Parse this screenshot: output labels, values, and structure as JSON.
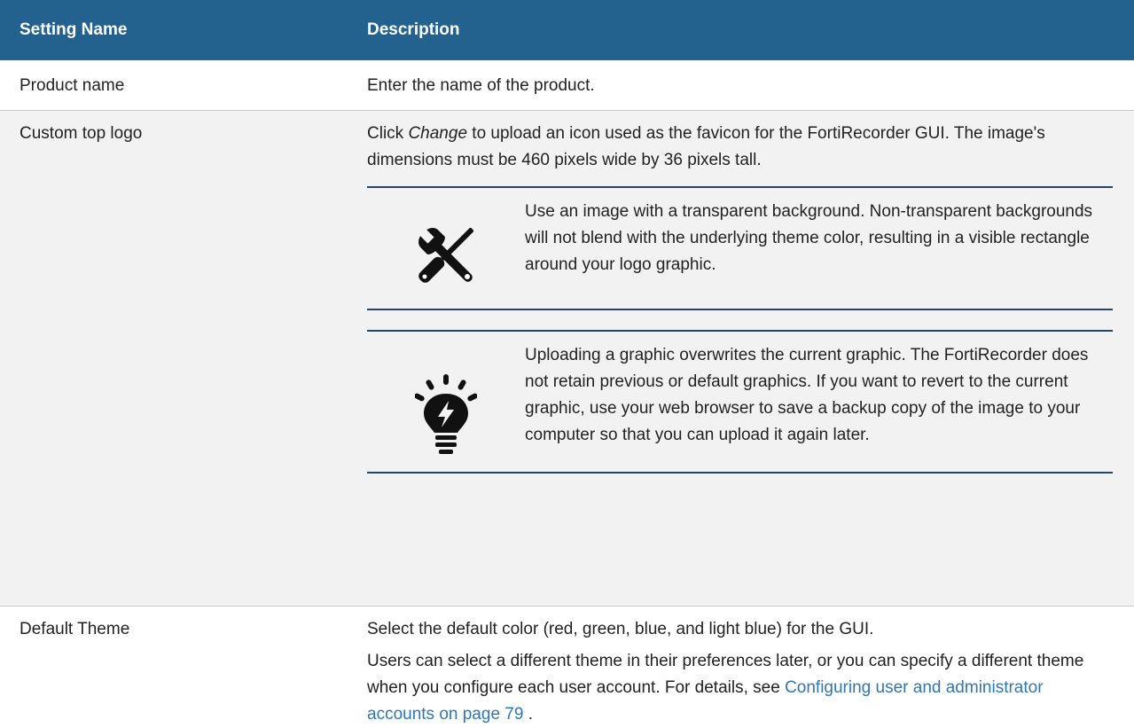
{
  "header": {
    "col1": "Setting Name",
    "col2": "Description"
  },
  "rows": [
    {
      "name": "Product name",
      "description": "Enter the name of the product."
    },
    {
      "name": "Custom top logo",
      "desc_pre": "Click ",
      "desc_em": "Change",
      "desc_post": " to upload an icon used as the favicon for the FortiRecorder GUI. The image's dimensions must be 460 pixels wide by 36 pixels tall.",
      "note_caution": {
        "icon": "tools-icon",
        "text": "Use an image with a transparent background. Non-transparent backgrounds will not blend with the underlying theme color, resulting in a visible rectangle around your logo graphic."
      },
      "note_tip": {
        "icon": "lightbulb-icon",
        "text": "Uploading a graphic overwrites the current graphic. The FortiRecorder does not retain previous or default graphics. If you want to revert to the current graphic, use your web browser to save a backup copy of the image to your computer so that you can upload it again later."
      }
    },
    {
      "name": "Default Theme",
      "desc_p1": "Select the default color (red, green, blue, and light blue) for the GUI.",
      "desc_p2_pre": "Users can select a different theme in their preferences later, or you can specify a different theme when you configure each user account. For details, see ",
      "desc_p2_link": "Configuring user and administrator accounts on page 79",
      "desc_p2_post": " ."
    }
  ],
  "colors": {
    "header_bg": "#23618f",
    "header_text": "#ffffff",
    "alt_row_bg": "#f2f2f2",
    "link": "#2e77b3",
    "note_rule": "#23466b"
  }
}
